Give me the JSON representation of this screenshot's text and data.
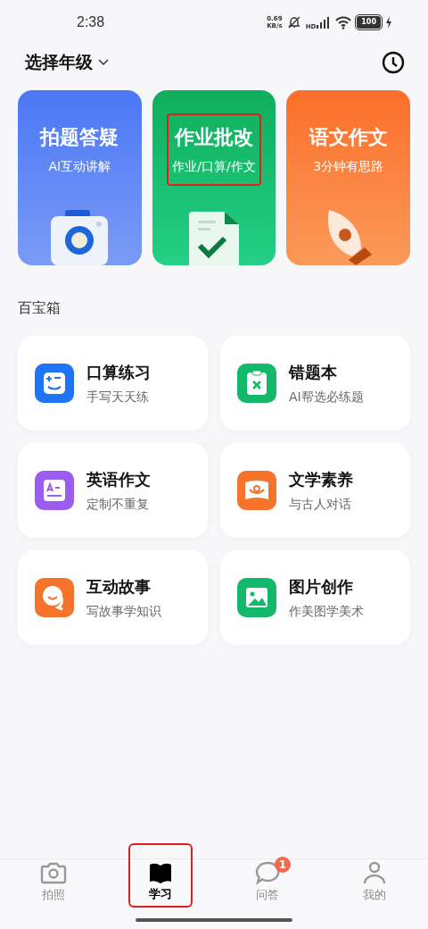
{
  "status_bar": {
    "time": "2:38",
    "net_speed": "0.69",
    "net_unit": "KB/s",
    "signal_label": "HD",
    "battery": "100"
  },
  "header": {
    "title": "选择年级"
  },
  "feature_cards": [
    {
      "title": "拍题答疑",
      "subtitle": "AI互动讲解",
      "kind": "camera",
      "annotated": false
    },
    {
      "title": "作业批改",
      "subtitle": "作业/口算/作文",
      "kind": "document",
      "annotated": true
    },
    {
      "title": "语文作文",
      "subtitle": "3分钟有思路",
      "kind": "pen",
      "annotated": false
    }
  ],
  "section_title": "百宝箱",
  "tools": [
    {
      "title": "口算练习",
      "subtitle": "手写天天练",
      "kind": "math",
      "color": "#1e74f5"
    },
    {
      "title": "错题本",
      "subtitle": "AI帮选必练题",
      "kind": "clipboard",
      "color": "#14b86a"
    },
    {
      "title": "英语作文",
      "subtitle": "定制不重复",
      "kind": "letter",
      "color": "#9b5cf0"
    },
    {
      "title": "文学素养",
      "subtitle": "与古人对话",
      "kind": "book",
      "color": "#f5732a"
    },
    {
      "title": "互动故事",
      "subtitle": "写故事学知识",
      "kind": "chat",
      "color": "#f5732a"
    },
    {
      "title": "图片创作",
      "subtitle": "作美图学美术",
      "kind": "image",
      "color": "#14b86a"
    }
  ],
  "nav": [
    {
      "label": "拍照",
      "kind": "camera",
      "selected": false,
      "annotated": false
    },
    {
      "label": "学习",
      "kind": "book",
      "selected": true,
      "annotated": true
    },
    {
      "label": "问答",
      "kind": "chat",
      "selected": false,
      "annotated": false,
      "badge": "1"
    },
    {
      "label": "我的",
      "kind": "person",
      "selected": false,
      "annotated": false
    }
  ]
}
